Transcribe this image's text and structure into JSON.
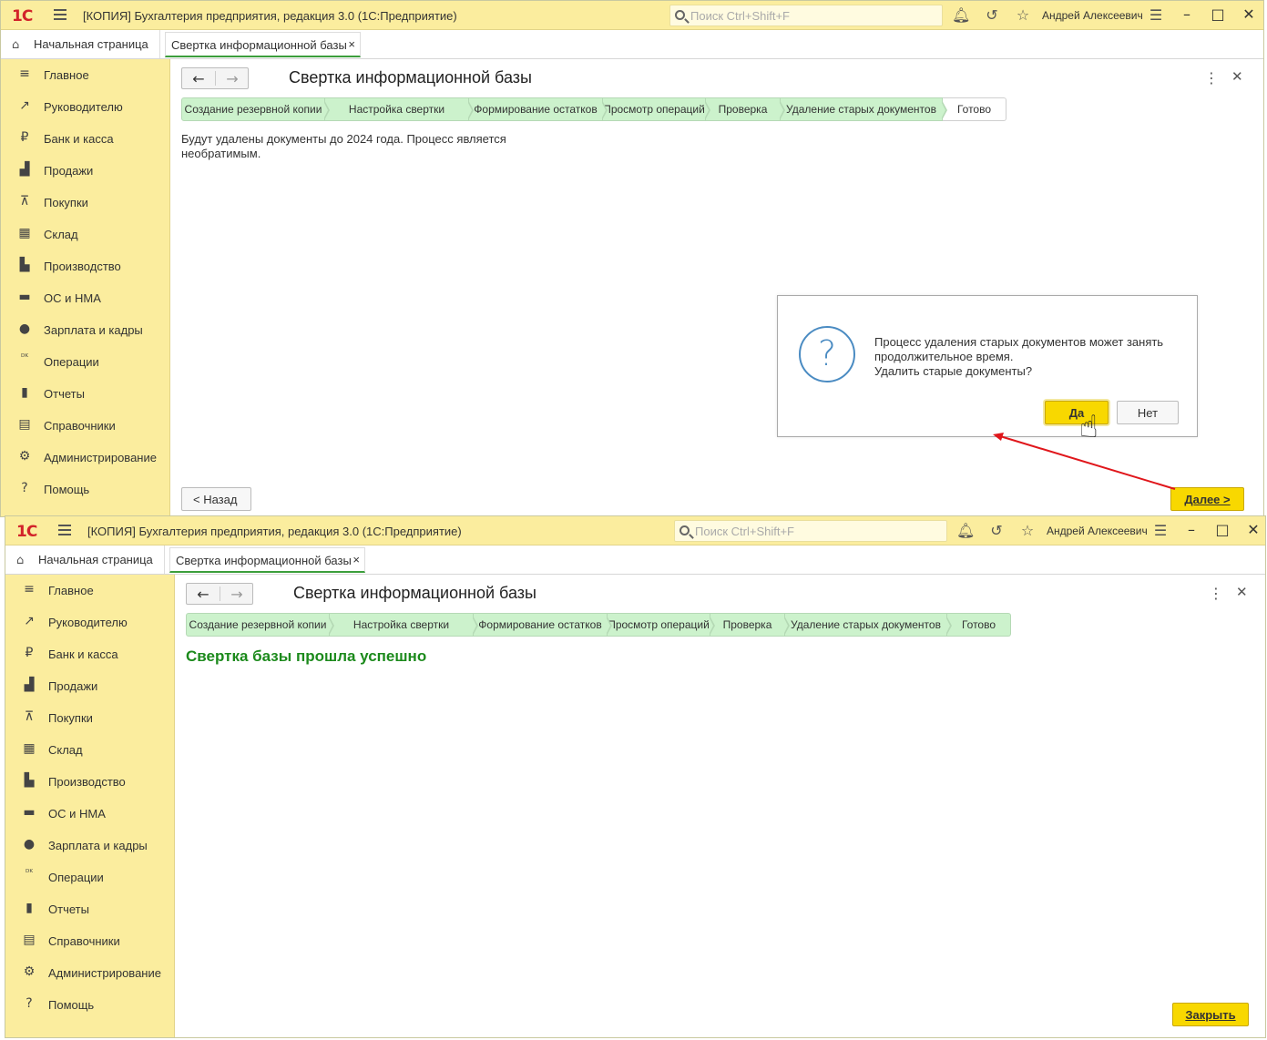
{
  "app": {
    "logo": "1С",
    "title": "[КОПИЯ] Бухгалтерия предприятия, редакция 3.0  (1С:Предприятие)",
    "search_placeholder": "Поиск Ctrl+Shift+F",
    "user": "Андрей Алексеевич"
  },
  "tabs": {
    "home": "Начальная страница",
    "doc": "Свертка информационной базы",
    "close": "×"
  },
  "sidebar": {
    "items": [
      {
        "label": "Главное",
        "icon": "menu-lines-icon",
        "glyph": "≡"
      },
      {
        "label": "Руководителю",
        "icon": "trend-chart-icon",
        "glyph": "↗"
      },
      {
        "label": "Банк и касса",
        "icon": "ruble-coin-icon",
        "glyph": "₽"
      },
      {
        "label": "Продажи",
        "icon": "shopping-bag-icon",
        "glyph": "▟"
      },
      {
        "label": "Покупки",
        "icon": "cart-icon",
        "glyph": "⊼"
      },
      {
        "label": "Склад",
        "icon": "warehouse-grid-icon",
        "glyph": "▦"
      },
      {
        "label": "Производство",
        "icon": "factory-icon",
        "glyph": "▙"
      },
      {
        "label": "ОС и НМА",
        "icon": "truck-icon",
        "glyph": "▬"
      },
      {
        "label": "Зарплата и кадры",
        "icon": "person-icon",
        "glyph": "●"
      },
      {
        "label": "Операции",
        "icon": "debit-credit-icon",
        "glyph": "ᴰᴷ"
      },
      {
        "label": "Отчеты",
        "icon": "bar-chart-icon",
        "glyph": "▮"
      },
      {
        "label": "Справочники",
        "icon": "books-icon",
        "glyph": "▤"
      },
      {
        "label": "Администрирование",
        "icon": "gear-icon",
        "glyph": "⚙"
      },
      {
        "label": "Помощь",
        "icon": "question-icon",
        "glyph": "?"
      }
    ]
  },
  "form": {
    "title": "Свертка информационной базы",
    "steps": [
      "Создание резервной копии",
      "Настройка свертки",
      "Формирование остатков",
      "Просмотр операций",
      "Проверка",
      "Удаление старых документов",
      "Готово"
    ]
  },
  "screen1": {
    "info": "Будут удалены документы до 2024 года. Процесс является необратимым.",
    "back_button": "< Назад",
    "next_button": "Далее >",
    "dialog": {
      "line1": "Процесс удаления старых документов может занять продолжительное время.",
      "line2": "Удалить старые документы?",
      "yes": "Да",
      "no": "Нет"
    }
  },
  "screen2": {
    "success": "Свертка базы прошла успешно",
    "close_button": "Закрыть"
  },
  "colors": {
    "titlebar": "#fbed9e",
    "step_done": "#ccf2cc",
    "accent_button": "#f8d800",
    "success_text": "#1c8a1c",
    "arrow": "#e0161b"
  }
}
